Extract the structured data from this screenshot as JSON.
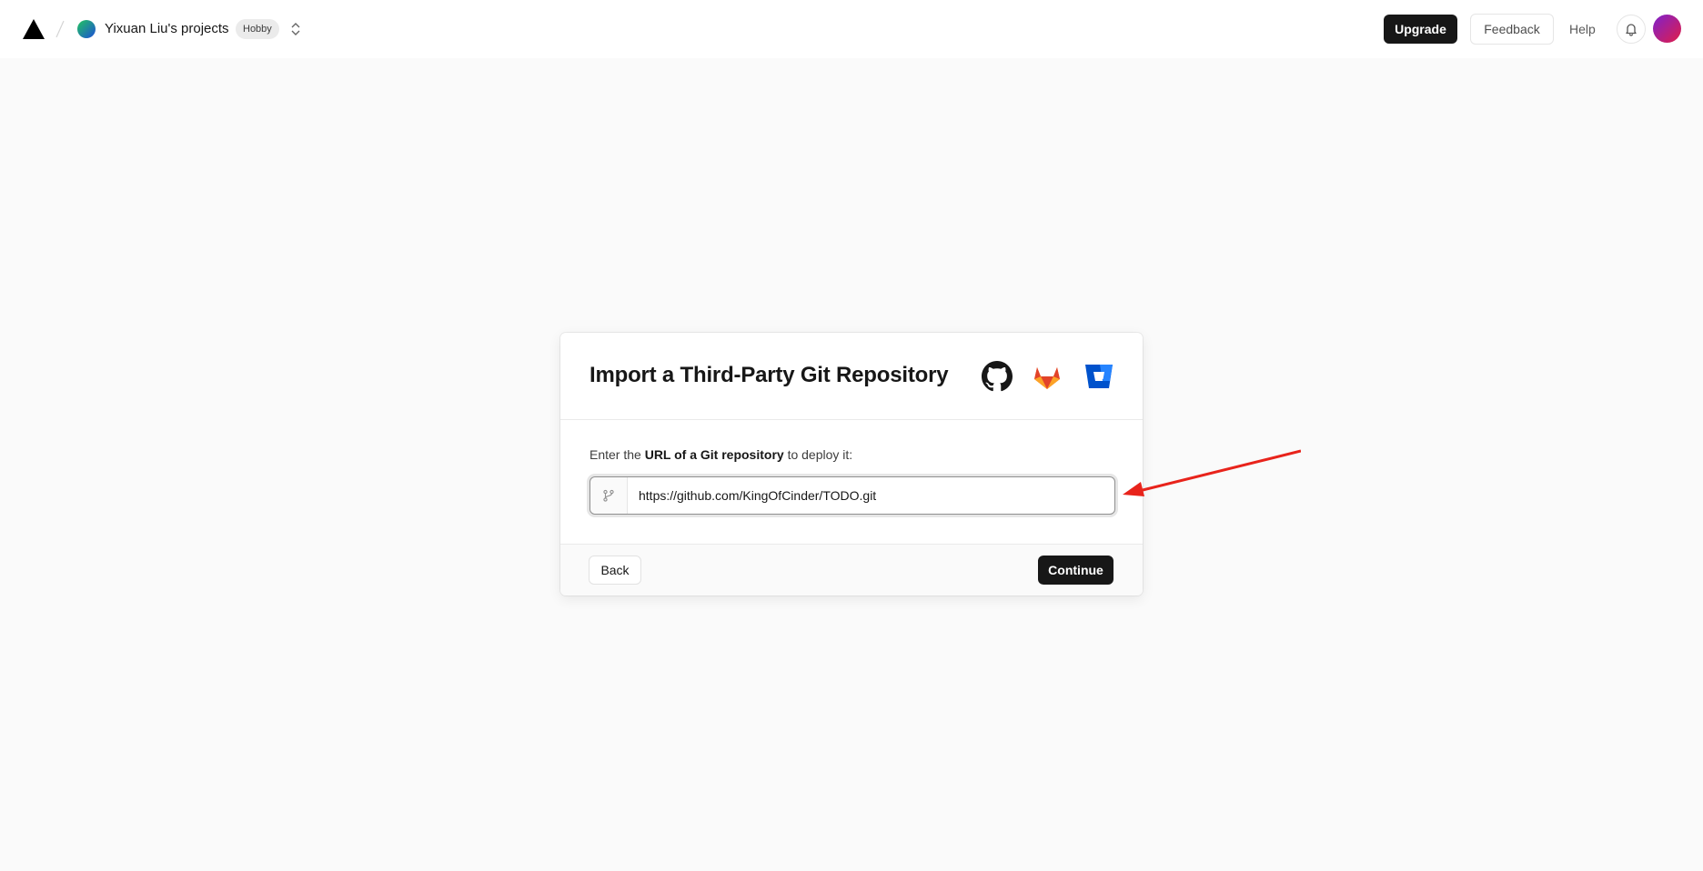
{
  "header": {
    "team_name": "Yixuan Liu's projects",
    "plan_badge": "Hobby",
    "upgrade_label": "Upgrade",
    "feedback_label": "Feedback",
    "help_label": "Help"
  },
  "import_card": {
    "title": "Import a Third-Party Git Repository",
    "providers": [
      "github-icon",
      "gitlab-icon",
      "bitbucket-icon"
    ],
    "prompt_prefix": "Enter the ",
    "prompt_bold": "URL of a Git repository",
    "prompt_suffix": " to deploy it:",
    "url_value": "https://github.com/KingOfCinder/TODO.git",
    "back_label": "Back",
    "continue_label": "Continue"
  },
  "colors": {
    "background": "#fafafa",
    "primary_button": "#171717",
    "annotation_arrow": "#e8231b",
    "gitlab_orange": "#fc6d26",
    "bitbucket_blue": "#2684ff"
  }
}
